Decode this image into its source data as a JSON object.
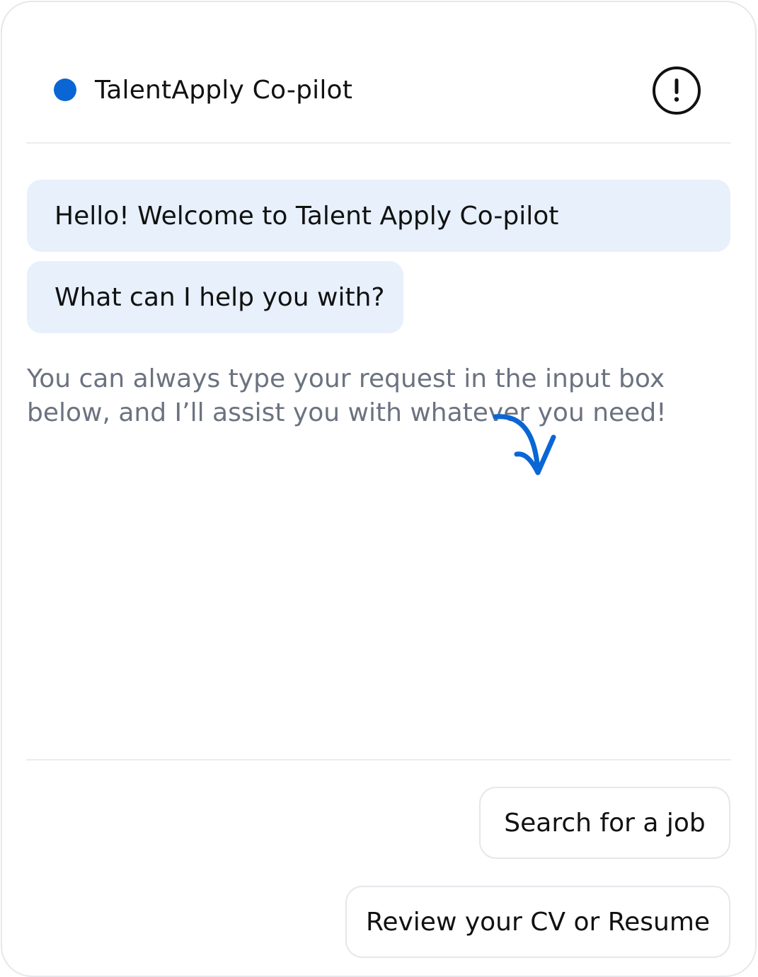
{
  "header": {
    "title": "TalentApply Co-pilot",
    "status_color": "#0a66d4",
    "info_icon": "exclamation-circle-icon"
  },
  "messages": [
    {
      "text": "Hello! Welcome to Talent Apply Co-pilot"
    },
    {
      "text": "What can I help you with?"
    }
  ],
  "hint": {
    "text": "You can always type your request in the input box below, and I’ll assist you with whatever you need!",
    "arrow_icon": "curved-arrow-down-icon",
    "arrow_color": "#0a66d4"
  },
  "suggestions": [
    {
      "label": "Search for a job"
    },
    {
      "label": "Review your CV or Resume"
    }
  ],
  "colors": {
    "accent": "#0a66d4",
    "bubble_bg": "#e7f0fb",
    "hint_text": "#6b7280",
    "border": "#e5e7eb"
  }
}
